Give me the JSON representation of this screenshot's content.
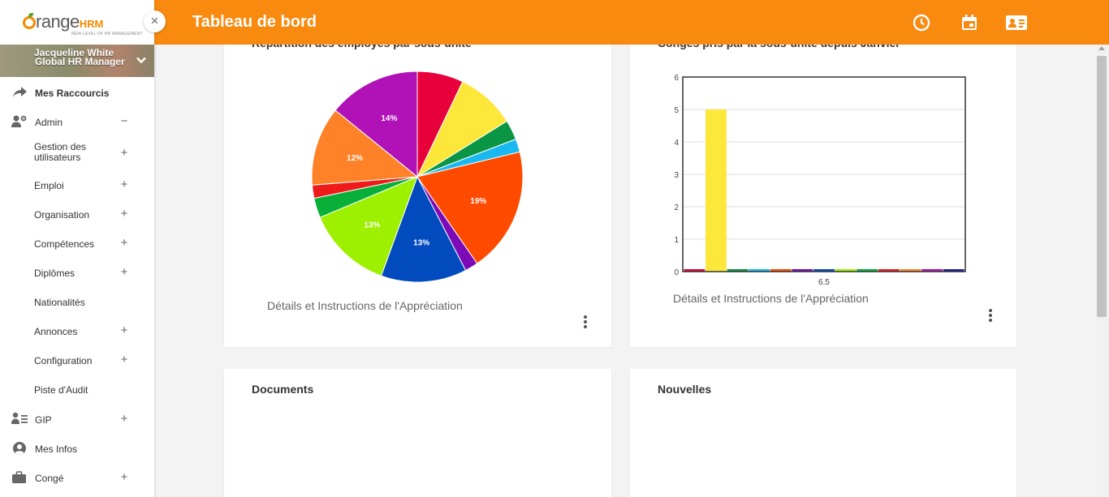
{
  "colors": {
    "header": "#f88a0f",
    "sidebar_bg": "#ffffff",
    "accent": "#f28c00"
  },
  "sidebar": {
    "logo": {
      "word": "range",
      "hrm": "HRM",
      "tagline": "NEW LEVEL OF HR MANAGEMENT"
    },
    "close_icon": "×",
    "user": {
      "name": "Jacqueline White",
      "role": "Global HR Manager"
    },
    "items": [
      {
        "label": "Mes Raccourcis",
        "icon": "share-arrow-icon",
        "sign": ""
      },
      {
        "label": "Admin",
        "icon": "users-gear-icon",
        "sign": "−"
      },
      {
        "label": "Gestion des utilisateurs",
        "sign": "+"
      },
      {
        "label": "Emploi",
        "sign": "+"
      },
      {
        "label": "Organisation",
        "sign": "+"
      },
      {
        "label": "Compétences",
        "sign": "+"
      },
      {
        "label": "Diplômes",
        "sign": "+"
      },
      {
        "label": "Nationalités",
        "sign": ""
      },
      {
        "label": "Annonces",
        "sign": "+"
      },
      {
        "label": "Configuration",
        "sign": "+"
      },
      {
        "label": "Piste d'Audit",
        "sign": ""
      },
      {
        "label": "GIP",
        "icon": "user-list-icon",
        "sign": "+"
      },
      {
        "label": "Mes Infos",
        "icon": "user-circle-icon",
        "sign": ""
      },
      {
        "label": "Congé",
        "icon": "briefcase-icon",
        "sign": "+"
      }
    ]
  },
  "header": {
    "title": "Tableau de bord",
    "icons": [
      "clock-icon",
      "calendar-icon",
      "contact-card-icon"
    ]
  },
  "cards": {
    "pie": {
      "title": "Répartition des employés par sous-unité",
      "subtitle": "Détails et Instructions de l'Appréciation"
    },
    "bar": {
      "title": "Congés pris par la sous-unité depuis Janvier",
      "subtitle": "Détails et Instructions de l'Appréciation"
    },
    "documents": {
      "title": "Documents"
    },
    "news": {
      "title": "Nouvelles"
    }
  },
  "chart_data": [
    {
      "type": "pie",
      "slices": [
        {
          "value": 7,
          "color": "#e8003a",
          "label": ""
        },
        {
          "value": 9,
          "color": "#fde73a",
          "label": ""
        },
        {
          "value": 3,
          "color": "#0a9645",
          "label": ""
        },
        {
          "value": 2,
          "color": "#19b8f0",
          "label": ""
        },
        {
          "value": 19,
          "color": "#ff4b00",
          "label": "19%"
        },
        {
          "value": 2,
          "color": "#7d0ab8",
          "label": ""
        },
        {
          "value": 13,
          "color": "#024bbf",
          "label": "13%"
        },
        {
          "value": 13,
          "color": "#9df000",
          "label": "13%"
        },
        {
          "value": 3,
          "color": "#08b03a",
          "label": ""
        },
        {
          "value": 2,
          "color": "#ef1a1a",
          "label": ""
        },
        {
          "value": 12,
          "color": "#ff8228",
          "label": "12%"
        },
        {
          "value": 14,
          "color": "#b012b8",
          "label": "14%"
        }
      ]
    },
    {
      "type": "bar",
      "categories": [
        "6.5"
      ],
      "ylim": [
        0,
        6
      ],
      "yticks": [
        "0",
        "1",
        "2",
        "3",
        "4",
        "5",
        "6"
      ],
      "series": [
        {
          "value": 0,
          "color": "#e8003a"
        },
        {
          "value": 5,
          "color": "#fde73a"
        },
        {
          "value": 0,
          "color": "#0a9645"
        },
        {
          "value": 0,
          "color": "#19b8f0"
        },
        {
          "value": 0,
          "color": "#ff4b00"
        },
        {
          "value": 0,
          "color": "#7d0ab8"
        },
        {
          "value": 0,
          "color": "#024bbf"
        },
        {
          "value": 0,
          "color": "#9df000"
        },
        {
          "value": 0,
          "color": "#08b03a"
        },
        {
          "value": 0,
          "color": "#ef1a1a"
        },
        {
          "value": 0,
          "color": "#ff8228"
        },
        {
          "value": 0,
          "color": "#b012b8"
        },
        {
          "value": 0,
          "color": "#1f1fa3"
        }
      ]
    }
  ]
}
